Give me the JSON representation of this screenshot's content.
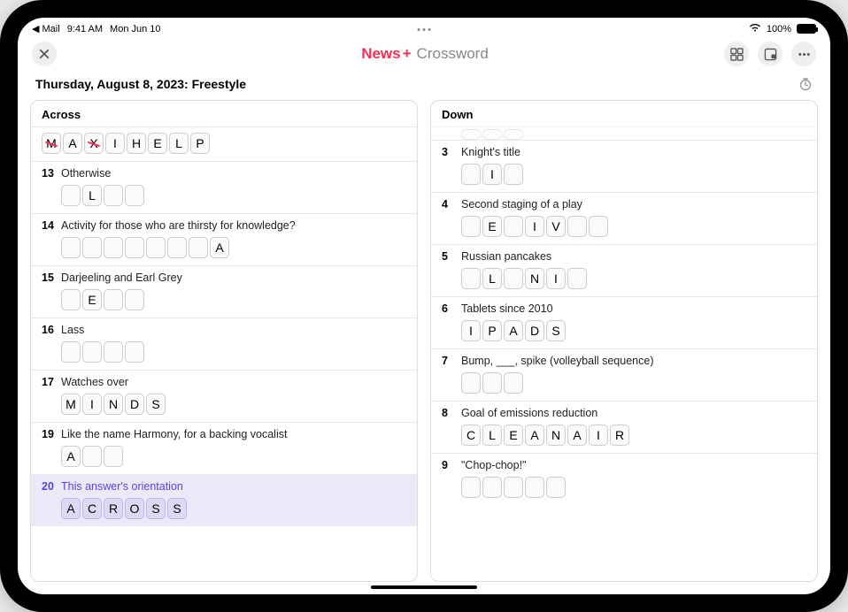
{
  "status": {
    "back_app": "◀ Mail",
    "time": "9:41 AM",
    "date": "Mon Jun 10",
    "battery_pct": "100%",
    "wifi": "wifi-icon"
  },
  "header": {
    "brand_prefix": "News",
    "brand_plus": "+",
    "brand_suffix": "Crossword"
  },
  "puzzle": {
    "title": "Thursday, August 8, 2023: Freestyle"
  },
  "across": {
    "label": "Across",
    "clues": [
      {
        "num": "",
        "text": "",
        "cells": [
          {
            "l": "M",
            "wrong": true
          },
          {
            "l": "A"
          },
          {
            "l": "X",
            "wrong": true
          },
          {
            "l": "I"
          },
          {
            "l": "H"
          },
          {
            "l": "E"
          },
          {
            "l": "L"
          },
          {
            "l": "P"
          }
        ]
      },
      {
        "num": "13",
        "text": "Otherwise",
        "cells": [
          {
            "l": ""
          },
          {
            "l": "L"
          },
          {
            "l": ""
          },
          {
            "l": ""
          }
        ]
      },
      {
        "num": "14",
        "text": "Activity for those who are thirsty for knowledge?",
        "cells": [
          {
            "l": ""
          },
          {
            "l": ""
          },
          {
            "l": ""
          },
          {
            "l": ""
          },
          {
            "l": ""
          },
          {
            "l": ""
          },
          {
            "l": ""
          },
          {
            "l": "A"
          }
        ]
      },
      {
        "num": "15",
        "text": "Darjeeling and Earl Grey",
        "cells": [
          {
            "l": ""
          },
          {
            "l": "E"
          },
          {
            "l": ""
          },
          {
            "l": ""
          }
        ]
      },
      {
        "num": "16",
        "text": "Lass",
        "cells": [
          {
            "l": ""
          },
          {
            "l": ""
          },
          {
            "l": ""
          },
          {
            "l": ""
          }
        ]
      },
      {
        "num": "17",
        "text": "Watches over",
        "cells": [
          {
            "l": "M"
          },
          {
            "l": "I"
          },
          {
            "l": "N"
          },
          {
            "l": "D"
          },
          {
            "l": "S"
          }
        ]
      },
      {
        "num": "19",
        "text": "Like the name Harmony, for a backing vocalist",
        "cells": [
          {
            "l": "A"
          },
          {
            "l": ""
          },
          {
            "l": ""
          }
        ]
      },
      {
        "num": "20",
        "text": "This answer's orientation",
        "active": true,
        "cells": [
          {
            "l": "A",
            "a": true
          },
          {
            "l": "C",
            "a": true
          },
          {
            "l": "R",
            "a": true
          },
          {
            "l": "O",
            "a": true
          },
          {
            "l": "S",
            "a": true
          },
          {
            "l": "S",
            "a": true
          }
        ]
      }
    ]
  },
  "down": {
    "label": "Down",
    "clues": [
      {
        "num": "3",
        "text": "Knight's title",
        "cells": [
          {
            "l": ""
          },
          {
            "l": "I"
          },
          {
            "l": ""
          }
        ]
      },
      {
        "num": "4",
        "text": "Second staging of a play",
        "cells": [
          {
            "l": ""
          },
          {
            "l": "E"
          },
          {
            "l": ""
          },
          {
            "l": "I"
          },
          {
            "l": "V"
          },
          {
            "l": ""
          },
          {
            "l": ""
          }
        ]
      },
      {
        "num": "5",
        "text": "Russian pancakes",
        "cells": [
          {
            "l": ""
          },
          {
            "l": "L"
          },
          {
            "l": ""
          },
          {
            "l": "N"
          },
          {
            "l": "I"
          },
          {
            "l": ""
          }
        ]
      },
      {
        "num": "6",
        "text": "Tablets since 2010",
        "cells": [
          {
            "l": "I"
          },
          {
            "l": "P"
          },
          {
            "l": "A"
          },
          {
            "l": "D"
          },
          {
            "l": "S"
          }
        ]
      },
      {
        "num": "7",
        "text": "Bump, ___, spike (volleyball sequence)",
        "cells": [
          {
            "l": ""
          },
          {
            "l": ""
          },
          {
            "l": ""
          }
        ]
      },
      {
        "num": "8",
        "text": "Goal of emissions reduction",
        "cells": [
          {
            "l": "C"
          },
          {
            "l": "L"
          },
          {
            "l": "E"
          },
          {
            "l": "A"
          },
          {
            "l": "N"
          },
          {
            "l": "A"
          },
          {
            "l": "I"
          },
          {
            "l": "R"
          }
        ]
      },
      {
        "num": "9",
        "text": "\"Chop-chop!\"",
        "cells": [
          {
            "l": ""
          },
          {
            "l": ""
          },
          {
            "l": ""
          },
          {
            "l": ""
          },
          {
            "l": ""
          }
        ]
      }
    ]
  }
}
